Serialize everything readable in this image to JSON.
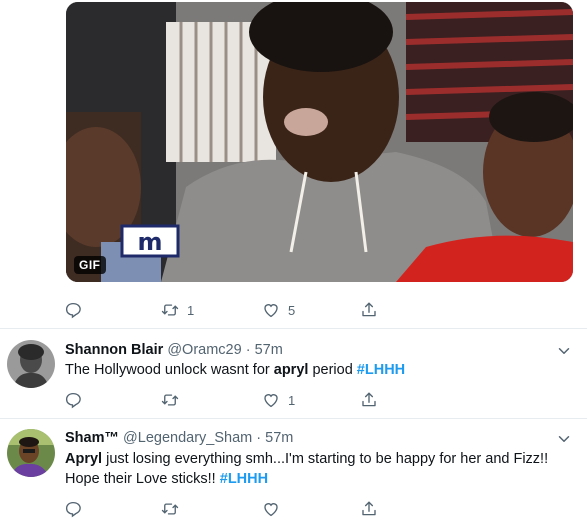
{
  "gif_tweet": {
    "badge": "GIF",
    "actions": {
      "reply": "",
      "retweet_count": "1",
      "like_count": "5"
    }
  },
  "tweets": [
    {
      "display_name": "Shannon Blair",
      "handle": "@Oramc29",
      "separator": "·",
      "time": "57m",
      "text_before": "The Hollywood unlock wasnt for ",
      "bold_word": "apryl",
      "text_after": " period ",
      "hashtag": "#LHHH",
      "retweet_count": "",
      "like_count": "1"
    },
    {
      "display_name": "Sham™",
      "handle": "@Legendary_Sham",
      "separator": "·",
      "time": "57m",
      "bold_word": "Apryl",
      "text_line1": " just losing everything smh...I'm starting to be happy for her and Fizz!!",
      "text_line2": "Hope their Love sticks!! ",
      "hashtag": "#LHHH",
      "retweet_count": "",
      "like_count": ""
    }
  ],
  "icons": {
    "reply": "reply-icon",
    "retweet": "retweet-icon",
    "like": "heart-icon",
    "share": "share-icon",
    "caret": "chevron-down-icon"
  },
  "colors": {
    "hashtag": "#1d9bf0",
    "secondary_text": "#536471",
    "divider": "#e6ecf0"
  }
}
